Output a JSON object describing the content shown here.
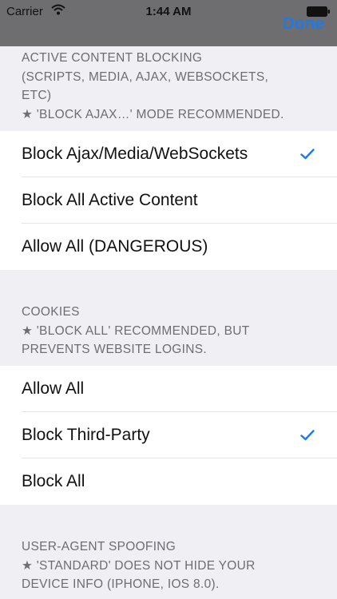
{
  "status_bar": {
    "carrier": "Carrier",
    "time": "1:44 AM"
  },
  "nav": {
    "done_label": "Done"
  },
  "sections": [
    {
      "header_lines": [
        "ACTIVE CONTENT BLOCKING",
        "(SCRIPTS, MEDIA, AJAX, WEBSOCKETS,",
        "ETC)",
        "★ 'BLOCK AJAX…' MODE RECOMMENDED."
      ],
      "options": [
        {
          "label": "Block Ajax/Media/WebSockets",
          "selected": true
        },
        {
          "label": "Block All Active Content",
          "selected": false
        },
        {
          "label": "Allow All (DANGEROUS)",
          "selected": false
        }
      ]
    },
    {
      "header_lines": [
        "COOKIES",
        "★ 'BLOCK ALL' RECOMMENDED, BUT",
        "PREVENTS WEBSITE LOGINS."
      ],
      "options": [
        {
          "label": "Allow All",
          "selected": false
        },
        {
          "label": "Block Third-Party",
          "selected": true
        },
        {
          "label": "Block All",
          "selected": false
        }
      ]
    },
    {
      "header_lines": [
        "USER-AGENT SPOOFING",
        "★ 'STANDARD' DOES NOT HIDE YOUR",
        "DEVICE INFO (IPHONE, IOS 8.0)."
      ]
    }
  ],
  "colors": {
    "accent": "#1f7ae6",
    "nav_background": "#6e6e70",
    "grouped_background": "#efeff4"
  },
  "icons": [
    "wifi-icon",
    "battery-icon",
    "checkmark-icon"
  ]
}
